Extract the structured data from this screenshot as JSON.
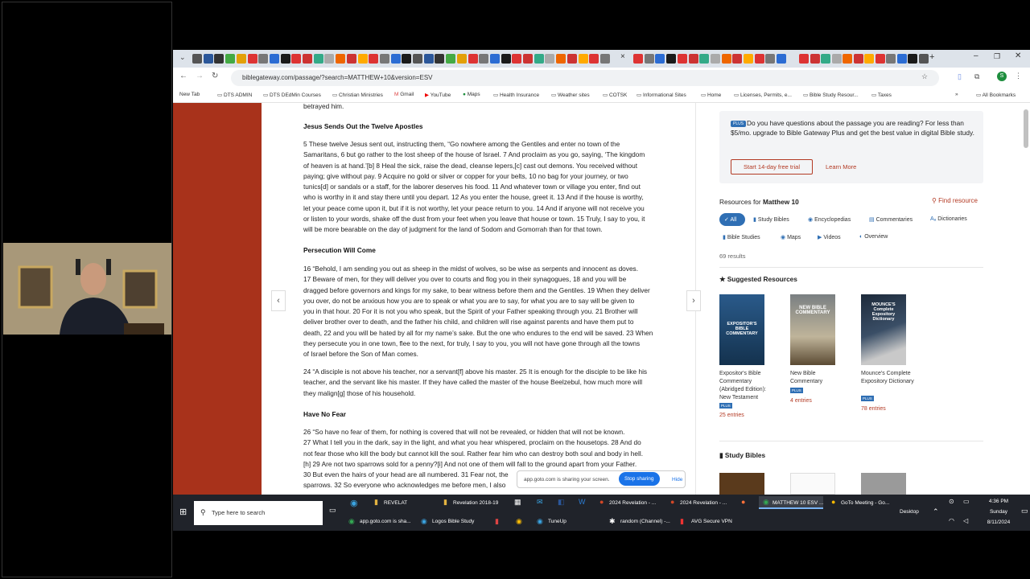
{
  "browser": {
    "url": "biblegateway.com/passage/?search=MATTHEW+10&version=ESV",
    "bookmarks": [
      "New Tab",
      "DTS ADMIN",
      "DTS DEdMin Courses",
      "Christian Ministries",
      "Gmail",
      "YouTube",
      "Maps",
      "Health Insurance",
      "Weather sites",
      "COTSK",
      "Informational Sites",
      "Home",
      "Licenses, Permits, e...",
      "Bible Study Resour...",
      "Taxes",
      "All Bookmarks"
    ]
  },
  "passage": {
    "top_line": "betrayed him.",
    "h1": "Jesus Sends Out the Twelve Apostles",
    "p1": [
      "5 These twelve Jesus sent out, instructing them, “Go nowhere among the Gentiles and enter no town of the",
      "Samaritans, 6 but go rather to the lost sheep of the house of Israel. 7 And proclaim as you go, saying, ‘The kingdom",
      "of heaven is at hand.’[b] 8 Heal the sick, raise the dead, cleanse lepers,[c] cast out demons. You received without",
      "paying; give without pay. 9 Acquire no gold or silver or copper for your belts, 10 no bag for your journey, or two",
      "tunics[d] or sandals or a staff, for the laborer deserves his food. 11 And whatever town or village you enter, find out",
      "who is worthy in it and stay there until you depart. 12 As you enter the house, greet it. 13 And if the house is worthy,",
      "let your peace come upon it, but if it is not worthy, let your peace return to you. 14 And if anyone will not receive you",
      "or listen to your words, shake off the dust from your feet when you leave that house or town. 15 Truly, I say to you, it",
      "will be more bearable on the day of judgment for the land of Sodom and Gomorrah than for that town."
    ],
    "h2": "Persecution Will Come",
    "p2": [
      "16 “Behold, I am sending you out as sheep in the midst of wolves, so be wise as serpents and innocent as doves.",
      "17 Beware of men, for they will deliver you over to courts and flog you in their synagogues, 18 and you will be",
      "dragged before governors and kings for my sake, to bear witness before them and the Gentiles. 19 When they deliver",
      "you over, do not be anxious how you are to speak or what you are to say, for what you are to say will be given to",
      "you in that hour. 20 For it is not you who speak, but the Spirit of your Father speaking through you. 21 Brother will",
      "deliver brother over to death, and the father his child, and children will rise against parents and have them put to",
      "death, 22 and you will be hated by all for my name’s sake. But the one who endures to the end will be saved. 23 When",
      "they persecute you in one town, flee to the next, for truly, I say to you, you will not have gone through all the towns",
      "of Israel before the Son of Man comes."
    ],
    "p3": [
      "24 “A disciple is not above his teacher, nor a servant[f] above his master. 25 It is enough for the disciple to be like his",
      "teacher, and the servant like his master. If they have called the master of the house Beelzebul, how much more will",
      "they malign[g] those of his household."
    ],
    "h3": "Have No Fear",
    "p4": [
      "26 “So have no fear of them, for nothing is covered that will not be revealed, or hidden that will not be known.",
      "27 What I tell you in the dark, say in the light, and what you hear whispered, proclaim on the housetops. 28 And do",
      "not fear those who kill the body but cannot kill the soul. Rather fear him who can destroy both soul and body in hell.",
      "[h] 29 Are not two sparrows sold for a penny?[i] And not one of them will fall to the ground apart from your Father.",
      "30 But even the hairs of your head are all numbered. 31 Fear not, the",
      "sparrows. 32 So everyone who acknowledges me before men, I also"
    ]
  },
  "sidebar": {
    "plus_badge": "PLUS",
    "promo": "Do you have questions about the passage you are reading? For less than $5/mo. upgrade to Bible Gateway Plus and get the best value in digital Bible study.",
    "trial_btn": "Start 14-day free trial",
    "learn_more": "Learn More",
    "resources_label": "Resources for",
    "resources_ref": "Matthew 10",
    "find_resource": "Find resource",
    "chips": [
      "All",
      "Study Bibles",
      "Encyclopedias",
      "Commentaries",
      "Dictionaries",
      "Bible Studies",
      "Maps",
      "Videos",
      "Overview"
    ],
    "results": "69 results",
    "suggested": "Suggested Resources",
    "books": [
      {
        "title": "Expositor's Bible Commentary (Abridged Edition): New Testament",
        "entries": "25 entries",
        "cover_text": "EXPOSITOR'S BIBLE COMMENTARY"
      },
      {
        "title": "New Bible Commentary",
        "entries": "4 entries",
        "cover_text": "NEW BIBLE COMMENTARY"
      },
      {
        "title": "Mounce's Complete Expository Dictionary",
        "entries": "78 entries",
        "cover_text": "MOUNCE'S Complete Expository Dictionary"
      }
    ],
    "study_bibles": "Study Bibles"
  },
  "share": {
    "text": "app.goto.com is sharing your screen.",
    "stop": "Stop sharing",
    "hide": "Hide"
  },
  "taskbar": {
    "search": "Type here to search",
    "top_items": [
      "REVELAT",
      "Revelation 2018-19",
      "2024 Revelation - ...",
      "2024 Revelation - ...",
      "MATTHEW 10 ESV ...",
      "GoTo Meeting - Go..."
    ],
    "bottom_items": [
      "app.goto.com is sha...",
      "Logos Bible Study",
      "TuneUp",
      "random (Channel) -...",
      "AVG Secure VPN"
    ],
    "desktop": "Desktop",
    "time": "4:36 PM",
    "day": "Sunday",
    "date": "8/11/2024"
  },
  "colors": {
    "red_side": "#a8321b",
    "accent_blue": "#1a73e8",
    "plus_blue": "#2f6fb4"
  }
}
